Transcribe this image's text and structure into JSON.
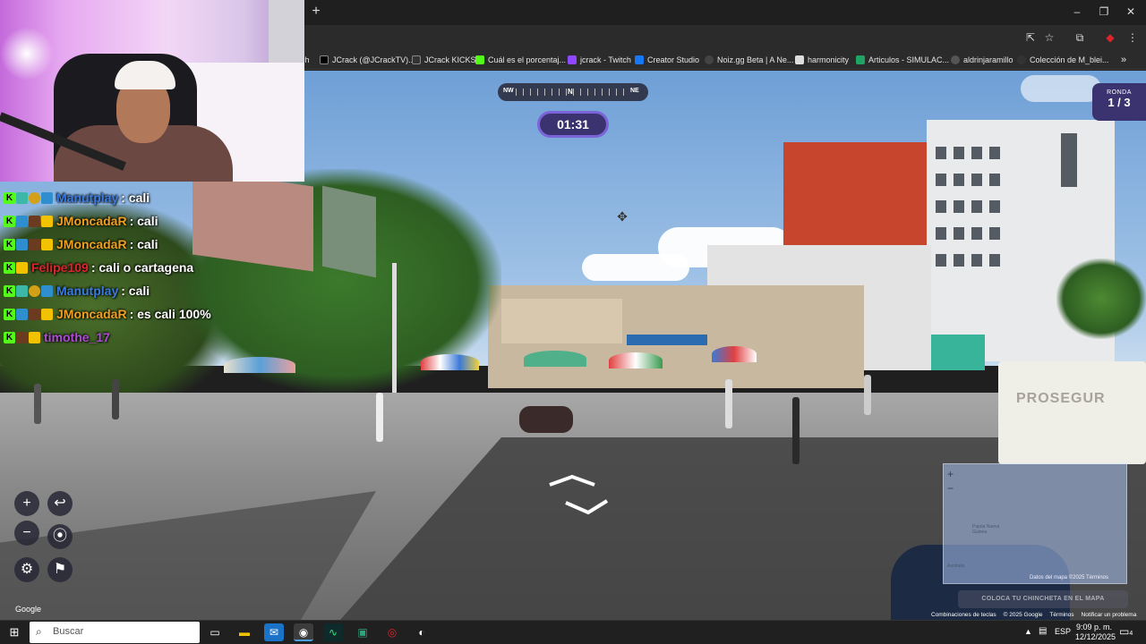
{
  "browser": {
    "new_tab_label": "+",
    "window_controls": [
      "–",
      "❐",
      "✕"
    ],
    "bookmarks": [
      {
        "label": "ch",
        "color": "#2b2b2b"
      },
      {
        "label": "JCrack (@JCrackTV)...",
        "color": "#000000"
      },
      {
        "label": "JCrack KICKS",
        "color": "#333333"
      },
      {
        "label": "Cuál es el porcentaj...",
        "color": "#53fc18"
      },
      {
        "label": "jcrack - Twitch",
        "color": "#9146ff"
      },
      {
        "label": "Creator Studio",
        "color": "#1877f2"
      },
      {
        "label": "Noiz.gg Beta | A Ne...",
        "color": "#444444"
      },
      {
        "label": "harmonicity",
        "color": "#dddddd"
      },
      {
        "label": "Articulos - SIMULAC...",
        "color": "#1fa463"
      },
      {
        "label": "aldrinjaramillo",
        "color": "#555555"
      },
      {
        "label": "Colección de M_blei...",
        "color": "#333333"
      }
    ],
    "more_bookmarks": "»"
  },
  "game": {
    "compass": {
      "left": "NW",
      "center": "N",
      "right": "NE"
    },
    "timer": "01:31",
    "round_label": "RONDA",
    "round_value": "1 / 3",
    "controls": {
      "zoom_in": "+",
      "zoom_out": "−",
      "undo": "↩",
      "pin": "⦿",
      "settings": "⚙",
      "flag": "⚑"
    },
    "minimap": {
      "plus": "+",
      "minus": "−",
      "places": "Papúa Nueva Guinea",
      "australia": "Australia",
      "credits": "Datos del mapa ©2025   Términos",
      "place_button": "COLOCA TU CHINCHETA EN EL MAPA"
    },
    "google_logo": "Google",
    "footer_links": [
      "Combinaciones de teclas",
      "© 2025 Google",
      "Términos",
      "Notificar un problema"
    ],
    "truck_text": "PROSEGUR"
  },
  "chat": [
    {
      "user": "Manutplay",
      "message": ": cali",
      "user_color": "#3a7be0",
      "badges": [
        "k",
        "green",
        "1",
        "blue"
      ]
    },
    {
      "user": "JMoncadaR",
      "message": ": cali",
      "user_color": "#f0a020",
      "badges": [
        "k",
        "blue",
        "u",
        "crown"
      ]
    },
    {
      "user": "JMoncadaR",
      "message": ": cali",
      "user_color": "#f0a020",
      "badges": [
        "k",
        "blue",
        "u",
        "crown"
      ]
    },
    {
      "user": "Felipe109",
      "message": ": cali o cartagena",
      "user_color": "#e0242c",
      "badges": [
        "k",
        "crown"
      ]
    },
    {
      "user": "Manutplay",
      "message": ": cali",
      "user_color": "#3a7be0",
      "badges": [
        "k",
        "green",
        "1",
        "blue"
      ]
    },
    {
      "user": "JMoncadaR",
      "message": ": es cali 100%",
      "user_color": "#f0a020",
      "badges": [
        "k",
        "blue",
        "u",
        "crown"
      ]
    },
    {
      "user": "timothe_17",
      "message": "",
      "user_color": "#b04ad8",
      "badges": [
        "k",
        "u",
        "crown"
      ]
    }
  ],
  "taskbar": {
    "search_placeholder": "Buscar",
    "language": "ESP",
    "time": "9:09 p. m.",
    "date": "12/12/2025",
    "notifications": "4"
  },
  "colors": {
    "accent": "#3b3370",
    "accent_border": "#7a64d8"
  }
}
